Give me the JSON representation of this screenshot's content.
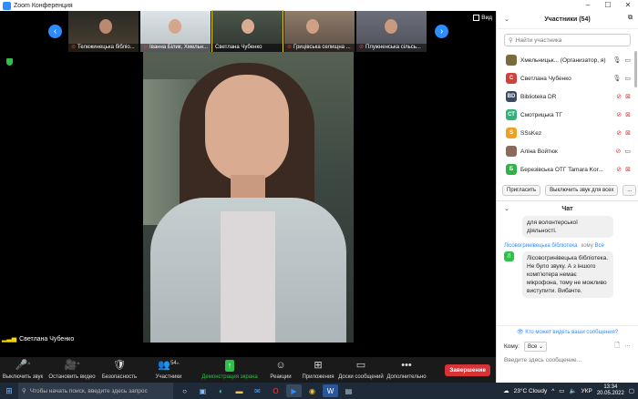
{
  "window": {
    "title": "Zoom Конференция"
  },
  "video": {
    "view_label": "Вид",
    "thumbnails": [
      {
        "name": "Тележинецька бібліо..."
      },
      {
        "name": "Іванна Білик, Хмельн..."
      },
      {
        "name": "Светлана Чубенко"
      },
      {
        "name": "Грицівська селищна ..."
      },
      {
        "name": "Плужненська сільсь..."
      }
    ],
    "speaker": "Светлана Чубенко"
  },
  "toolbar": {
    "mute": "Выключить звук",
    "stop_video": "Остановить видео",
    "security": "Безопасность",
    "participants": "Участники",
    "participants_count": "54",
    "share_screen": "Демонстрация экрана",
    "reactions": "Реакции",
    "apps": "Приложения",
    "whiteboards": "Доски сообщений",
    "more": "Дополнительно",
    "end": "Завершение"
  },
  "participants_panel": {
    "title": "Участники (54)",
    "search_placeholder": "Найти участника",
    "list": [
      {
        "initials": "",
        "name": "Хмельницьк...  (Организатор, я)",
        "color": "#7a6b3c",
        "mic": "on",
        "cam": "on"
      },
      {
        "initials": "С",
        "name": "Светлана Чубенко",
        "color": "#d0413a",
        "mic": "on",
        "cam": "on"
      },
      {
        "initials": "BD",
        "name": "Biblioteka DR",
        "color": "#3b4a63",
        "mic": "off",
        "cam": "off"
      },
      {
        "initials": "СТ",
        "name": "Смотрицька ТГ",
        "color": "#2fb37a",
        "mic": "off",
        "cam": "off"
      },
      {
        "initials": "S",
        "name": "SSsKez",
        "color": "#f0a020",
        "mic": "off",
        "cam": "off"
      },
      {
        "initials": "",
        "name": "Аліна Войтюк",
        "color": "#8a6a5a",
        "mic": "off",
        "cam": "on"
      },
      {
        "initials": "Б",
        "name": "Березівська ОТГ Tamara Kor...",
        "color": "#2fb348",
        "mic": "off",
        "cam": "off"
      }
    ],
    "invite": "Пригласить",
    "mute_all": "Выключить звук для всех",
    "more": "..."
  },
  "chat": {
    "title": "Чат",
    "prev_message": "для волонтерської діяльності.",
    "message": {
      "avatar": "Л",
      "from": "Лісовогринівецька бібліотека",
      "to_label": "кому",
      "to": "Все",
      "text": "Лісовогринівецька бібліотека. Не було звуку. А з іншого комп'ютера немає мікрофона, тому не можливо виступити. Вибачте."
    },
    "who_can_see": "Кто может видеть ваши сообщения?",
    "to_label": "Кому:",
    "to_value": "Все",
    "input_placeholder": "Введите здесь сообщение..."
  },
  "taskbar": {
    "search_placeholder": "Чтобы начать поиск, введите здесь запрос",
    "weather": "23°C  Cloudy",
    "lang": "УКР",
    "time": "13:34",
    "date": "20.05.2022"
  }
}
